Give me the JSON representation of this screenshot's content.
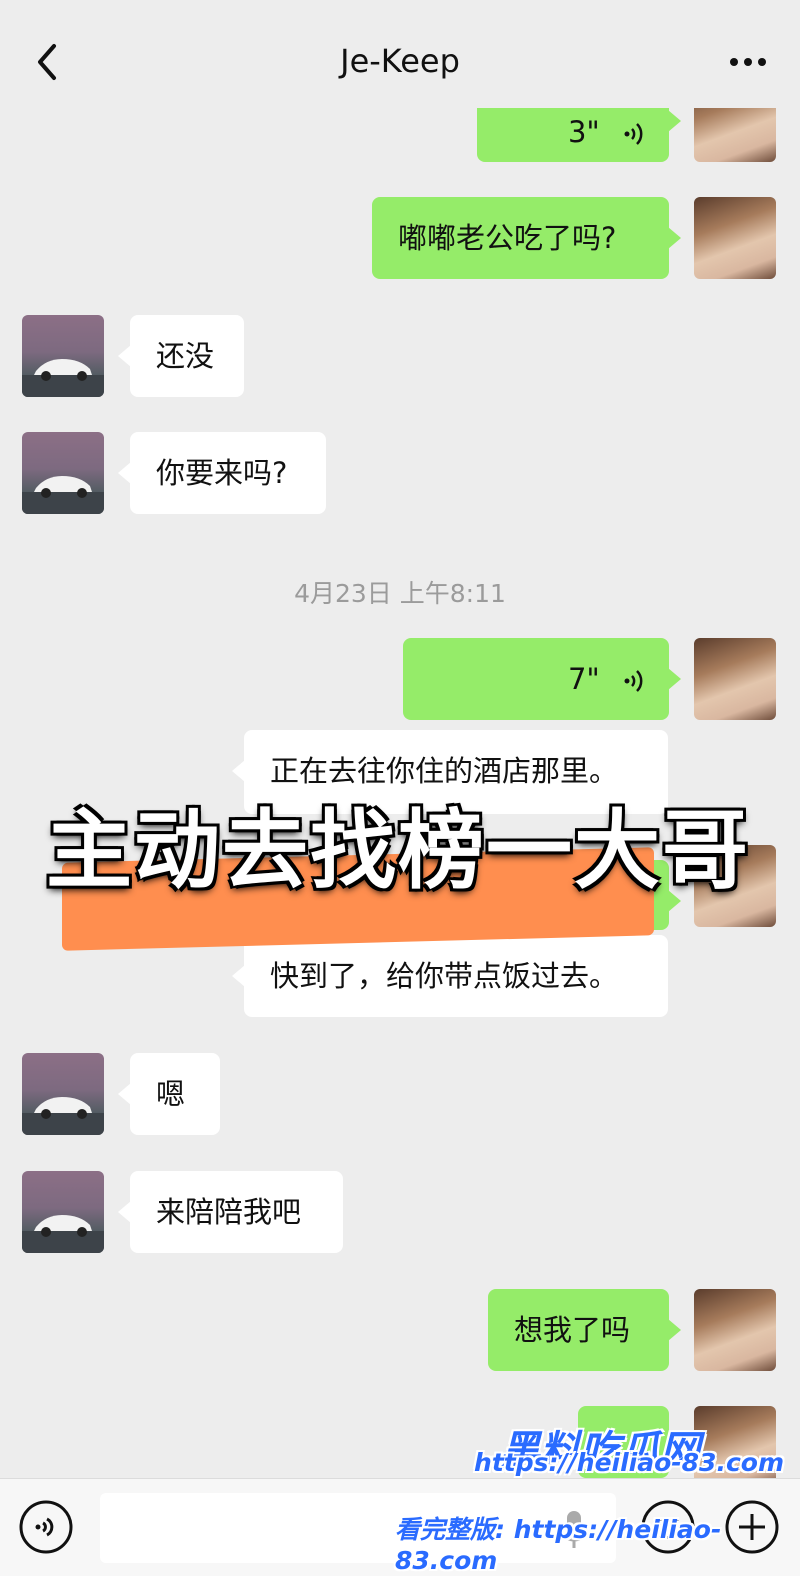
{
  "header": {
    "title": "Je-Keep"
  },
  "messages": [
    {
      "side": "me",
      "type": "voice",
      "duration": "3\""
    },
    {
      "side": "me",
      "type": "text",
      "text": "嘟嘟老公吃了吗?"
    },
    {
      "side": "other",
      "type": "text",
      "text": "还没"
    },
    {
      "side": "other",
      "type": "text",
      "text": "你要来吗?"
    },
    {
      "side": "me",
      "type": "voice",
      "duration": "7\""
    },
    {
      "side": "other",
      "type": "text",
      "text": "正在去往你住的酒店那里。"
    },
    {
      "side": "other",
      "type": "text",
      "text": "快到了，给你带点饭过去。"
    },
    {
      "side": "other",
      "type": "text",
      "text": "嗯"
    },
    {
      "side": "other",
      "type": "text",
      "text": "来陪陪我吧"
    },
    {
      "side": "me",
      "type": "text",
      "text": "想我了吗"
    }
  ],
  "timestamp": "4月23日 上午8:11",
  "overlay": {
    "caption": "主动去找榜一大哥"
  },
  "watermark": {
    "logo": "黑料吃瓜网",
    "url": "https://heiliao-83.com",
    "full_prefix": "看完整版: https://heiliao-83.com"
  },
  "colors": {
    "my_bubble": "#95ec69",
    "their_bubble": "#ffffff",
    "background": "#ededed",
    "highlight_stripe": "#ff8e4f"
  }
}
